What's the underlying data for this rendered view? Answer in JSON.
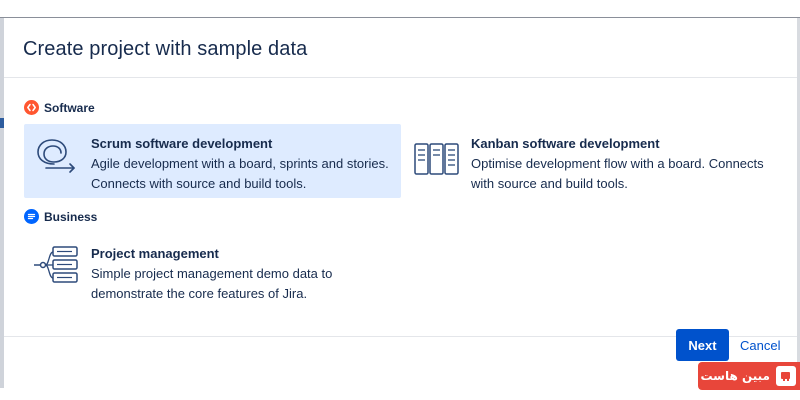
{
  "modal": {
    "title": "Create project with sample data"
  },
  "sections": {
    "software": {
      "label": "Software",
      "icon": "code-brackets-icon",
      "color": "#ff5630"
    },
    "business": {
      "label": "Business",
      "icon": "document-lines-icon",
      "color": "#0065ff"
    }
  },
  "templates": {
    "scrum": {
      "title": "Scrum software development",
      "description": "Agile development with a board, sprints and stories. Connects with source and build tools.",
      "icon": "scrum-loop-icon",
      "selected": true
    },
    "kanban": {
      "title": "Kanban software development",
      "description": "Optimise development flow with a board. Connects with source and build tools.",
      "icon": "kanban-board-icon",
      "selected": false
    },
    "project": {
      "title": "Project management",
      "description": "Simple project management demo data to demonstrate the core features of Jira.",
      "icon": "project-stack-icon",
      "selected": false
    }
  },
  "footer": {
    "next_label": "Next",
    "cancel_label": "Cancel"
  },
  "watermark": {
    "text": "مبین هاست",
    "icon": "mobin-host-logo-icon"
  },
  "colors": {
    "primary": "#0052cc",
    "selected_bg": "#deebff",
    "text": "#172b4d",
    "icon_stroke": "#2d4a7a",
    "watermark_bg": "#e8463a"
  }
}
